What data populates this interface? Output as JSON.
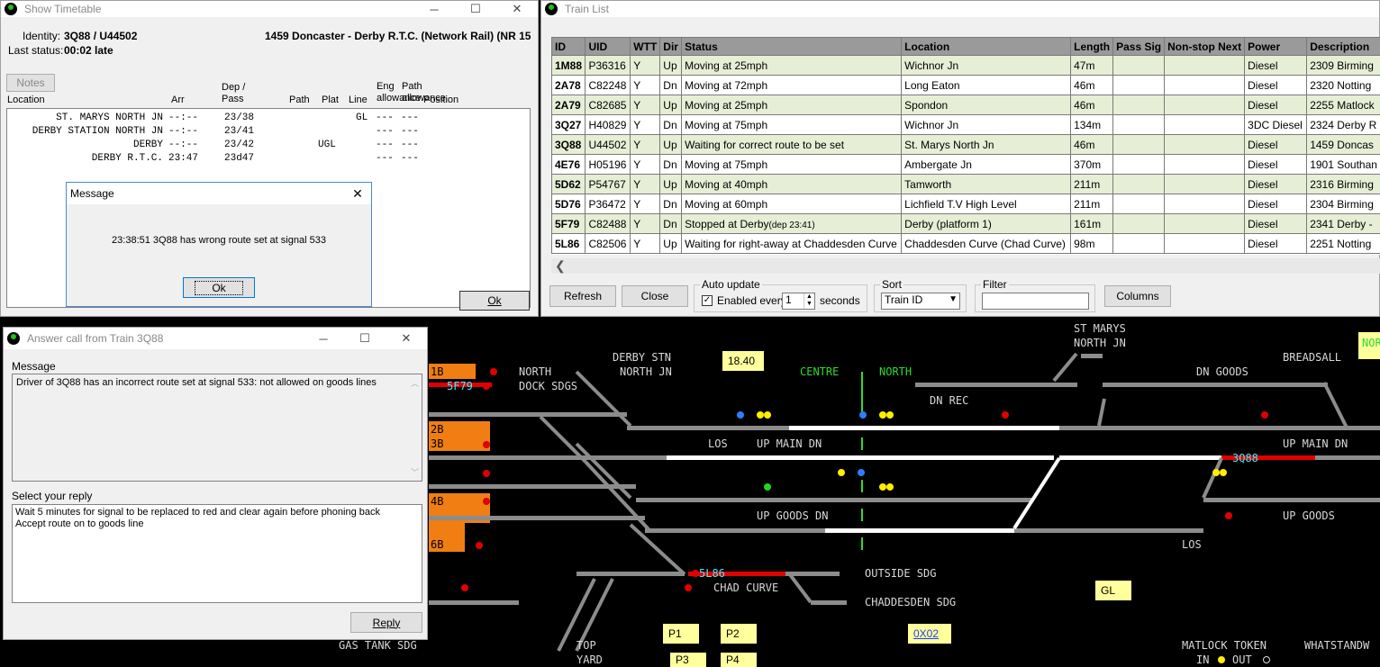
{
  "timetable": {
    "title": "Show Timetable",
    "identity_label": "Identity:",
    "identity": "3Q88 / U44502",
    "service": "1459 Doncaster - Derby R.T.C. (Network Rail) (NR 15",
    "last_status_label": "Last status:",
    "last_status": "00:02 late",
    "notes_button": "Notes",
    "headers": {
      "location": "Location",
      "arr": "Arr",
      "dep_pass": "Dep / Pass",
      "path": "Path",
      "plat": "Plat",
      "line": "Line",
      "eng": "Eng allowance",
      "path_alw": "Path allowance",
      "position": "Position"
    },
    "rows": [
      {
        "location": "ST. MARYS NORTH JN",
        "arr": "--:--",
        "dep": "23/38",
        "path": "",
        "plat": "",
        "line": "GL",
        "eng": "---",
        "pal": "---"
      },
      {
        "location": "DERBY STATION NORTH JN",
        "arr": "--:--",
        "dep": "23/41",
        "path": "",
        "plat": "",
        "line": "",
        "eng": "---",
        "pal": "---"
      },
      {
        "location": "DERBY",
        "arr": "--:--",
        "dep": "23/42",
        "path": "",
        "plat": "UGL",
        "line": "",
        "eng": "---",
        "pal": "---"
      },
      {
        "location": "DERBY R.T.C.",
        "arr": "23:47",
        "dep": "23d47",
        "path": "",
        "plat": "",
        "line": "",
        "eng": "---",
        "pal": "---"
      }
    ],
    "ok_button": "Ok"
  },
  "message": {
    "title": "Message",
    "text": "23:38:51 3Q88 has wrong route set at signal 533",
    "ok_button": "Ok"
  },
  "trainlist": {
    "title": "Train List",
    "columns": [
      "ID",
      "UID",
      "WTT",
      "Dir",
      "Status",
      "Location",
      "Length",
      "Pass Sig",
      "Non-stop Next",
      "Power",
      "Description"
    ],
    "rows": [
      [
        "1M88",
        "P36316",
        "Y",
        "Up",
        "Moving at 25mph",
        "Wichnor Jn",
        "47m",
        "",
        "",
        "Diesel",
        "2309 Birming"
      ],
      [
        "2A78",
        "C82248",
        "Y",
        "Dn",
        "Moving at 72mph",
        "Long Eaton",
        "46m",
        "",
        "",
        "Diesel",
        "2320 Notting"
      ],
      [
        "2A79",
        "C82685",
        "Y",
        "Up",
        "Moving at 25mph",
        "Spondon",
        "46m",
        "",
        "",
        "Diesel",
        "2255 Matlock"
      ],
      [
        "3Q27",
        "H40829",
        "Y",
        "Dn",
        "Moving at 75mph",
        "Wichnor Jn",
        "134m",
        "",
        "",
        "3DC Diesel",
        "2324 Derby R"
      ],
      [
        "3Q88",
        "U44502",
        "Y",
        "Up",
        "Waiting for correct route to be set",
        "St. Marys North Jn",
        "46m",
        "",
        "",
        "Diesel",
        "1459 Doncas"
      ],
      [
        "4E76",
        "H05196",
        "Y",
        "Dn",
        "Moving at 75mph",
        "Ambergate Jn",
        "370m",
        "",
        "",
        "Diesel",
        "1901 Southan"
      ],
      [
        "5D62",
        "P54767",
        "Y",
        "Up",
        "Moving at 40mph",
        "Tamworth",
        "211m",
        "",
        "",
        "Diesel",
        "2316 Birming"
      ],
      [
        "5D76",
        "P36472",
        "Y",
        "Dn",
        "Moving at 60mph",
        "Lichfield T.V High Level",
        "211m",
        "",
        "",
        "Diesel",
        "2304 Birming"
      ],
      [
        "5F79",
        "C82488",
        "Y",
        "Dn",
        "Stopped at Derby",
        "Derby (platform 1)",
        "161m",
        "",
        "",
        "Diesel",
        "2341 Derby -"
      ],
      [
        "5L86",
        "C82506",
        "Y",
        "Up",
        "Waiting for right-away at Chaddesden Curve",
        "Chaddesden Curve (Chad Curve)",
        "98m",
        "",
        "",
        "Diesel",
        "2251 Notting"
      ]
    ],
    "row8_suffix": "(dep 23:41)",
    "refresh": "Refresh",
    "close": "Close",
    "auto_update": "Auto update",
    "enabled_every": "Enabled every",
    "interval": "1",
    "seconds": "seconds",
    "sort": "Sort",
    "sort_value": "Train ID",
    "filter": "Filter",
    "filter_value": "",
    "columns_button": "Columns"
  },
  "answer": {
    "title": "Answer call from Train 3Q88",
    "message_label": "Message",
    "message_text": "Driver of 3Q88 has an incorrect route set at signal 533: not allowed on goods lines",
    "reply_label": "Select your reply",
    "replies": [
      "Wait 5 minutes for signal to be replaced to red and clear again before phoning back",
      "Accept route on to goods line"
    ],
    "reply_button": "Reply"
  },
  "panel": {
    "labels": {
      "derby_stn": "DERBY STN",
      "north_jn": "NORTH JN",
      "north": "NORTH",
      "dock_sdgs": "DOCK SDGS",
      "centre": "CENTRE",
      "north2": "NORTH",
      "st_marys": "ST MARYS",
      "north_jn2": "NORTH JN",
      "breadsall": "BREADSALL",
      "dn_goods": "DN GOODS",
      "dn_rec": "DN REC",
      "los1": "LOS",
      "up_main_dn": "UP MAIN DN",
      "up_main_dn2": "UP MAIN DN",
      "up_goods_dn": "UP GOODS DN",
      "up_goods": "UP GOODS",
      "los2": "LOS",
      "outside_sdg": "OUTSIDE SDG",
      "chad_curve": "CHAD CURVE",
      "chaddesden_sdg": "CHADDESDEN SDG",
      "gas_tank": "GAS TANK SDG",
      "top": "TOP",
      "yard": "YARD",
      "matlock_token": "MATLOCK TOKEN",
      "in_out": "IN",
      "out": "OUT",
      "whatstandwell": "WHATSTANDW",
      "nor": "NOR"
    },
    "time": "18.40",
    "gl": "GL",
    "p1": "P1",
    "p2": "P2",
    "p3": "P3",
    "p4": "P4",
    "ox": "0X02",
    "trains": {
      "t5f79": "5F79",
      "t3q88": "3Q88",
      "t5l86": "5L86"
    },
    "berths": [
      "1B",
      "2B",
      "3B",
      "4B",
      "6B"
    ]
  }
}
